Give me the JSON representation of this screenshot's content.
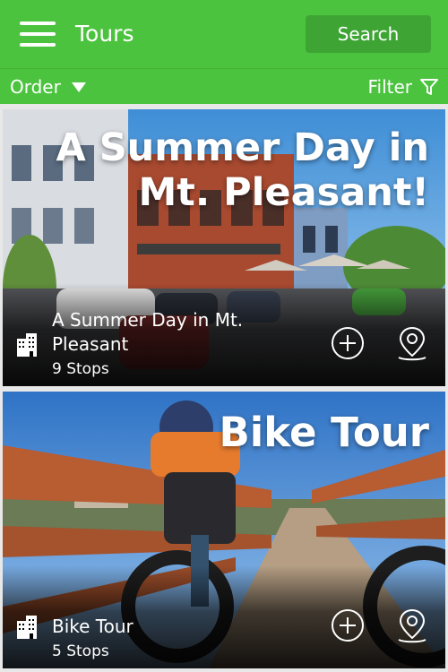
{
  "header": {
    "title": "Tours",
    "search_label": "Search",
    "menu_icon": "hamburger-menu-icon"
  },
  "toolbar": {
    "order_label": "Order",
    "filter_label": "Filter"
  },
  "tours": [
    {
      "hero_title": "A Summer Day in Mt. Pleasant!",
      "name": "A Summer Day in Mt. Pleasant",
      "stops": "9 Stops"
    },
    {
      "hero_title": "Bike Tour",
      "name": "Bike Tour",
      "stops": "5 Stops"
    }
  ],
  "colors": {
    "header_green": "#4cc33f",
    "search_green": "#3ea535"
  }
}
